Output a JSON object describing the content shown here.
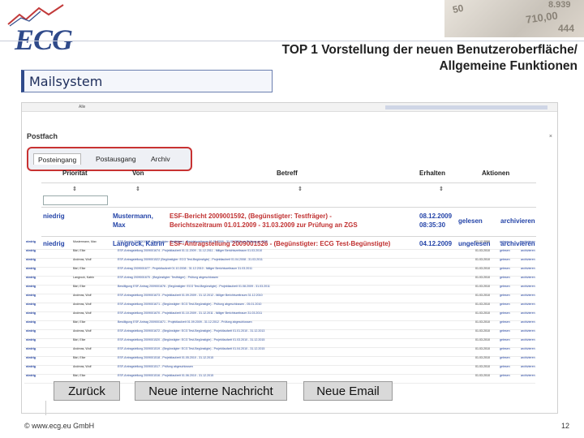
{
  "header": {
    "logo_text": "ECG",
    "section_label": "Mailsystem",
    "title_line1": "TOP 1 Vorstellung der neuen Benutzeroberfläche/",
    "title_line2": "Allgemeine Funktionen",
    "money_numbers": [
      "50",
      "710,00",
      "8.939",
      "444"
    ]
  },
  "app": {
    "topbar_right": "Alle",
    "mailbox_title": "Postfach",
    "close_glyph": "×",
    "tabs": [
      "Posteingang",
      "Postausgang",
      "Archiv"
    ],
    "active_tab": "Posteingang",
    "columns": [
      "Priorität",
      "Von",
      "Betreff",
      "Erhalten",
      "Aktionen"
    ],
    "sort_glyph": "⇕",
    "rows": [
      {
        "priority": "niedrig",
        "from_line1": "Mustermann,",
        "from_line2": "Max",
        "subject_line1": "ESF-Bericht 2009001592, (Begünstigter: Testfräger) -",
        "subject_line2": "Berichtszeitraum 01.01.2009 - 31.03.2009 zur Prüfung an ZGS",
        "received_line1": "08.12.2009",
        "received_line2": "08:35:30",
        "status": "gelesen",
        "action": "archivieren"
      },
      {
        "priority": "niedrig",
        "from_line1": "Langrock, Katrin",
        "from_line2": "",
        "subject_line1": "ESF-Antragstellung 2009001526 - (Begünstigter: ECG Test-Begünstigte)",
        "subject_line2": "",
        "received_line1": "04.12.2009",
        "received_line2": "",
        "status": "ungelesen",
        "action": "archivieren"
      }
    ],
    "small_rows": [
      {
        "p": "niedrig",
        "n": "Mustermann, Max",
        "b": "ESF-Bericht 2009001592 (Begünstigter: Testfräger) - Berichtszeitraum 01.01.2009 - 31.03.2009 zur Prüfung an ZGS",
        "d": "01.12.2009",
        "s": "gelesen",
        "a": "archivieren"
      },
      {
        "p": "niedrig",
        "n": "Bärl, Elke",
        "b": "ESF-Antragstellung 2009001674 - Projektlaufzeit 01.11.2009 - 31.12.2011 - fälliger Berichtszeitraum 01.03.2010",
        "d": "01.03.2010",
        "s": "gelesen",
        "a": "archivieren"
      },
      {
        "p": "niedrig",
        "n": "Andreas, Wolf",
        "b": "ESF-Antragstellung 2009001522 (Begünstigter: ECG Test-Begünstigte) - Projektlaufzeit 01.04.2008 - 31.03.2011",
        "d": "01.03.2010",
        "s": "gelesen",
        "a": "archivieren"
      },
      {
        "p": "niedrig",
        "n": "Bärl, Elke",
        "b": "ESF-Antrag 2009001677 - Projektlaufzeit 01.10.2008 - 31.12.2010 - fälliger Berichtszeitraum 31.03.2011",
        "d": "01.03.2010",
        "s": "gelesen",
        "a": "archivieren"
      },
      {
        "p": "niedrig",
        "n": "Langrock, Katrin",
        "b": "ESF-Antrag 2009001675 - (Begünstigter: Testfräger) - Prüfung abgeschlossen",
        "d": "01.03.2010",
        "s": "gelesen",
        "a": "archivieren"
      },
      {
        "p": "niedrig",
        "n": "Bärl, Elke",
        "b": "Bewilligung ESF-Antrag 2009001676 - (Begünstigter: ECG Test-Begünstigte) - Projektlaufzeit 01.08.2009 - 31.03.2011",
        "d": "01.03.2010",
        "s": "gelesen",
        "a": "archivieren"
      },
      {
        "p": "niedrig",
        "n": "Andreas, Wolf",
        "b": "ESF-Antragstellung 2009001673 - Projektlaufzeit 01.09.2009 - 31.12.2012 - fälliger Berichtszeitraum 31.12.2010",
        "d": "01.03.2010",
        "s": "gelesen",
        "a": "archivieren"
      },
      {
        "p": "niedrig",
        "n": "Andreas, Wolf",
        "b": "ESF-Antragstellung 2009001671 - (Begünstigter: ECG Test-Begünstigte) - Prüfung abgeschlossen - 05.01.2010",
        "d": "01.03.2010",
        "s": "gelesen",
        "a": "archivieren"
      },
      {
        "p": "niedrig",
        "n": "Andreas, Wolf",
        "b": "ESF-Antragstellung 2009001670 - Projektlaufzeit 01.10.2009 - 31.12.2011 - fälliger Berichtszeitraum 31.03.2011",
        "d": "01.03.2010",
        "s": "gelesen",
        "a": "archivieren"
      },
      {
        "p": "niedrig",
        "n": "Bärl, Elke",
        "b": "Bewilligung ESF-Antrag 2009001671 - Projektlaufzeit 01.09.2009 - 31.12.2012 - Prüfung abgeschlossen",
        "d": "01.03.2010",
        "s": "gelesen",
        "a": "archivieren"
      },
      {
        "p": "niedrig",
        "n": "Andreas, Wolf",
        "b": "ESF-Antragstellung 2009001672 - (Begünstigter: ECG Test-Begünstigte) - Projektlaufzeit 01.01.2010 - 31.12.2013",
        "d": "01.03.2010",
        "s": "gelesen",
        "a": "archivieren"
      },
      {
        "p": "niedrig",
        "n": "Bärl, Elke",
        "b": "ESF-Antragstellung 2009001520 - (Begünstigter: ECG Test-Begünstigte) - Projektlaufzeit 01.03.2010 - 31.12.2015",
        "d": "01.03.2010",
        "s": "gelesen",
        "a": "archivieren"
      },
      {
        "p": "niedrig",
        "n": "Andreas, Wolf",
        "b": "ESF-Antragstellung 2009001519 - (Begünstigter: ECG Test-Begünstigte) - Projektlaufzeit 01.04.2010 - 31.12.2015",
        "d": "01.03.2010",
        "s": "gelesen",
        "a": "archivieren"
      },
      {
        "p": "niedrig",
        "n": "Bärl, Elke",
        "b": "ESF-Antragstellung 2009001518 - Projektlaufzeit 01.05.2010 - 31.12.2015",
        "d": "01.03.2010",
        "s": "gelesen",
        "a": "archivieren"
      },
      {
        "p": "niedrig",
        "n": "Andreas, Wolf",
        "b": "ESF-Antragstellung 2009001517 - Prüfung abgeschlossen",
        "d": "01.03.2010",
        "s": "gelesen",
        "a": "archivieren"
      },
      {
        "p": "niedrig",
        "n": "Bärl, Elke",
        "b": "ESF-Antragstellung 2009001516 - Projektlaufzeit 01.06.2010 - 31.12.2015",
        "d": "01.03.2010",
        "s": "gelesen",
        "a": "archivieren"
      }
    ]
  },
  "buttons": {
    "back": "Zurück",
    "new_internal": "Neue interne Nachricht",
    "new_email": "Neue Email"
  },
  "footer": {
    "copyright": "© www.ecg.eu GmbH",
    "page_number": "12"
  }
}
